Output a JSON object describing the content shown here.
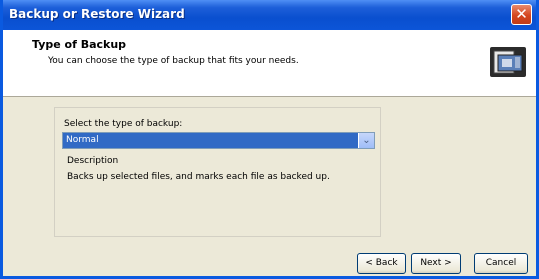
{
  "window": {
    "title": "Backup or Restore Wizard",
    "close_glyph": "✕"
  },
  "header": {
    "title": "Type of Backup",
    "subtitle": "You can choose the type of backup that fits your needs."
  },
  "main": {
    "select_label": "Select the type of backup:",
    "select_value": "Normal",
    "description_label": "Description",
    "description_text": "Backs up selected files, and marks each file as backed up."
  },
  "buttons": {
    "back": "< Back",
    "next": "Next >",
    "cancel": "Cancel"
  },
  "icons": {
    "header": "backup-wizard-icon",
    "dropdown": "chevron-down-icon"
  },
  "colors": {
    "titlebar": "#0a4fcf",
    "selection": "#316ac5",
    "window": "#ece9d8"
  }
}
